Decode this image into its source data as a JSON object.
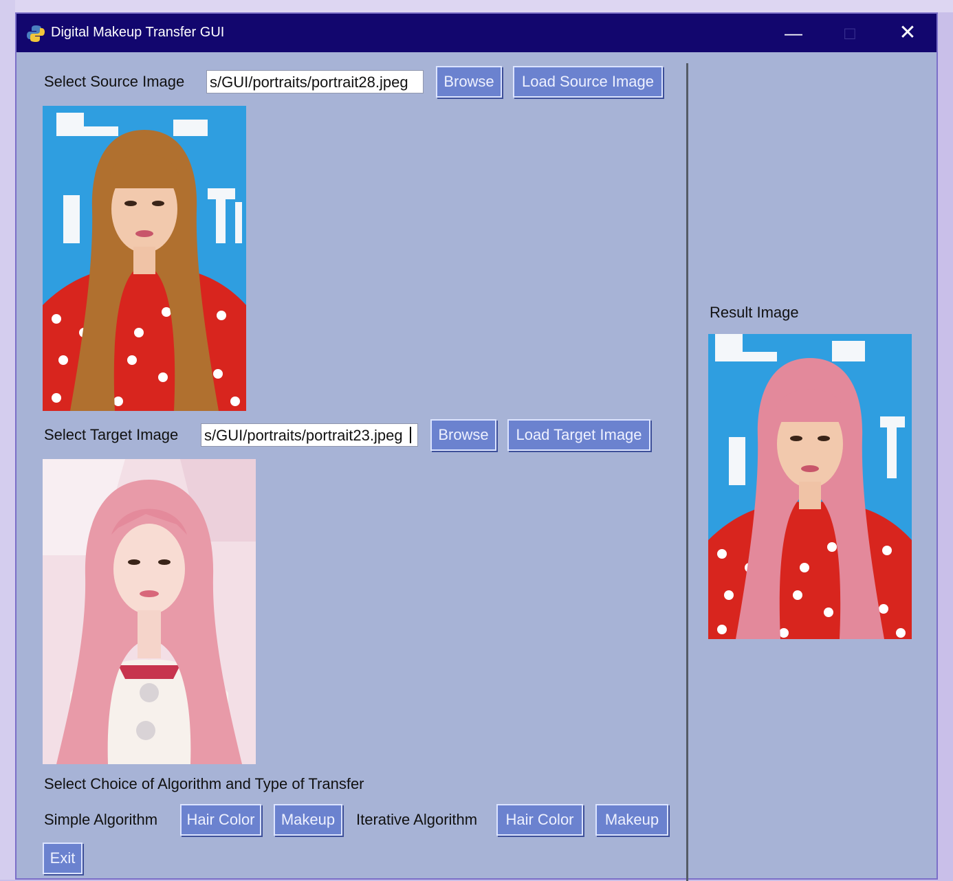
{
  "window": {
    "title": "Digital Makeup Transfer GUI",
    "controls": {
      "minimize": "—",
      "maximize": "□",
      "close": "✕"
    }
  },
  "source": {
    "label": "Select Source Image",
    "path_value": "s/GUI/portraits/portrait28.jpeg",
    "browse_label": "Browse",
    "load_label": "Load Source Image"
  },
  "target": {
    "label": "Select Target Image",
    "path_value": "s/GUI/portraits/portrait23.jpeg",
    "browse_label": "Browse",
    "load_label": "Load Target Image"
  },
  "result": {
    "label": "Result Image"
  },
  "algorithms": {
    "heading": "Select Choice of Algorithm and Type of Transfer",
    "simple_label": "Simple Algorithm",
    "simple_hair": "Hair Color",
    "simple_makeup": "Makeup",
    "iterative_label": "Iterative Algorithm",
    "iterative_hair": "Hair Color",
    "iterative_makeup": "Makeup"
  },
  "exit_label": "Exit",
  "colors": {
    "window_bg": "#a7b3d6",
    "titlebar": "#12066e",
    "button": "#6b82cf",
    "hair_source": "#b0702f",
    "hair_pink": "#e89aa8",
    "dress_red": "#d8251e",
    "backdrop_blue": "#2f9ee0"
  }
}
